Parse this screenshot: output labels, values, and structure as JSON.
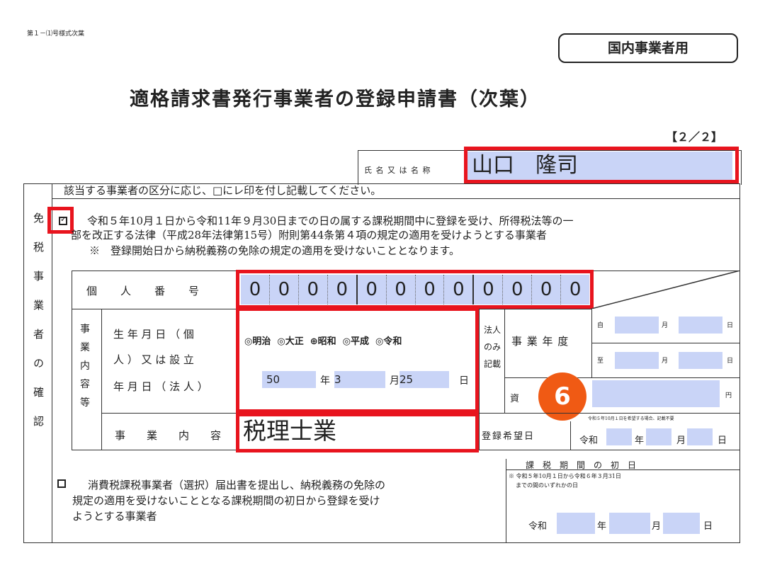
{
  "form_code": "第１－⑴号様式次葉",
  "badge": "国内事業者用",
  "title": "適格請求書発行事業者の登録申請書（次葉）",
  "page_indicator": "【２／２】",
  "name_label": "氏 名 又 は 名 称",
  "name_value": "山口　隆司",
  "instruction": "該当する事業者の区分に応じ、□にレ印を付し記載してください。",
  "left_section_label": "免税事業者の確認",
  "exemption": {
    "checked": true,
    "line1": "令和５年10月１日から令和11年９月30日までの日の属する課税期間中に登録を受け、所得税法等の一",
    "line2": "部を改正する法律（平成28年法律第15号）附則第44条第４項の規定の適用を受けようとする事業者",
    "note": "※　登録開始日から納税義務の免除の規定の適用を受けないこととなります。"
  },
  "personal_number": {
    "label": "個　　人　　番　　号",
    "digits": [
      "0",
      "0",
      "0",
      "0",
      "0",
      "0",
      "0",
      "0",
      "0",
      "0",
      "0",
      "0"
    ]
  },
  "business": {
    "side_label": "事業内容等",
    "birth_label_1": "生 年 月 日 （ 個",
    "birth_label_2": "人 ） 又 は 設 立",
    "birth_label_3": "年 月 日 （ 法 人 ）",
    "eras": [
      "明治",
      "大正",
      "昭和",
      "平成",
      "令和"
    ],
    "selected_era": "昭和",
    "year": "50",
    "month": "3",
    "day": "25",
    "year_unit": "年",
    "month_unit": "月",
    "day_unit": "日",
    "content_label": "事　　業　　内　　容",
    "content_value": "税理士業"
  },
  "corp_only_label": "法人のみ記載",
  "fiscal_year": {
    "label": "事 業 年 度",
    "from": "自",
    "to": "至",
    "month": "月",
    "day": "日"
  },
  "capital": {
    "label": "資",
    "unit": "円"
  },
  "registration_note": "令和５年10月１日を希望する場合、記載不要",
  "registration": {
    "label": "登録希望日",
    "era": "令和",
    "year_unit": "年",
    "month_unit": "月",
    "day_unit": "日"
  },
  "step_badge": "6",
  "election": {
    "checked": false,
    "line1": "消費税課税事業者（選択）届出書を提出し、納税義務の免除の",
    "line2": "規定の適用を受けないこととなる課税期間の初日から登録を受け",
    "line3": "ようとする事業者"
  },
  "tax_period": {
    "header": "課　税　期　間　の　初　日",
    "note1": "※ 令和５年10月１日から令和６年３月31日",
    "note2": "までの間のいずれかの日",
    "era": "令和",
    "year_unit": "年",
    "month_unit": "月",
    "day_unit": "日"
  },
  "colors": {
    "highlight_red": "#e8141e",
    "field_blue": "#c9d4f7",
    "badge_orange": "#f05a14"
  }
}
